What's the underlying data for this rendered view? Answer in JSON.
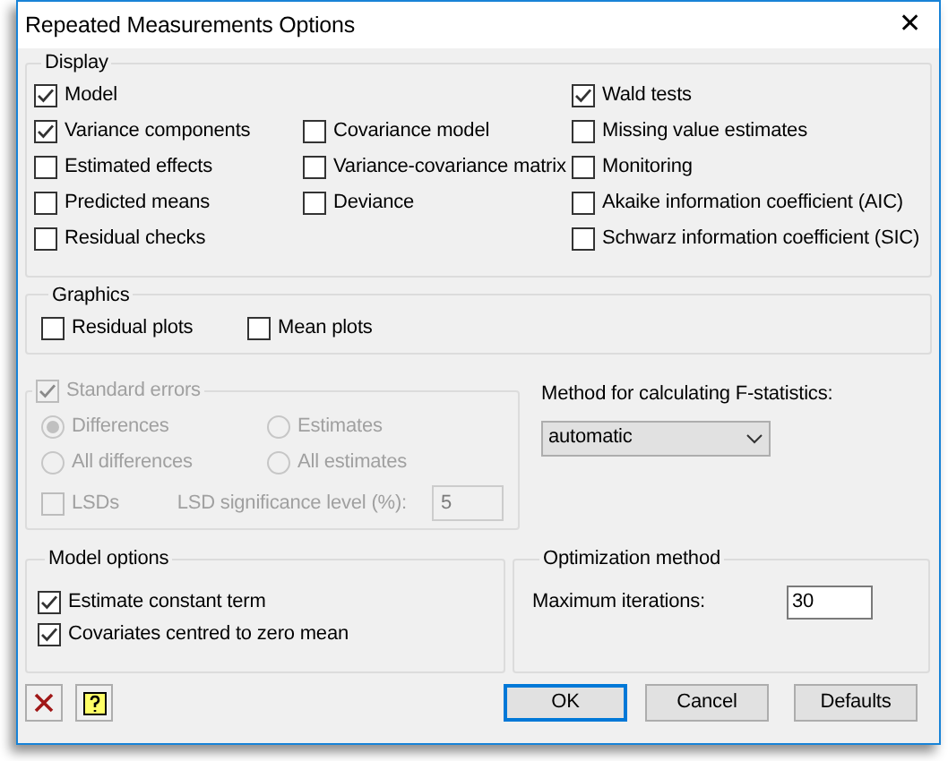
{
  "window": {
    "title": "Repeated Measurements Options",
    "close": "✕"
  },
  "display": {
    "title": "Display",
    "columns": [
      [
        {
          "label": "Model",
          "checked": true
        },
        {
          "label": "Variance components",
          "checked": true
        },
        {
          "label": "Estimated effects",
          "checked": false
        },
        {
          "label": "Predicted means",
          "checked": false
        },
        {
          "label": "Residual checks",
          "checked": false
        }
      ],
      [
        {
          "label": "Covariance model",
          "checked": false
        },
        {
          "label": "Variance-covariance matrix",
          "checked": false
        },
        {
          "label": "Deviance",
          "checked": false
        }
      ],
      [
        {
          "label": "Wald tests",
          "checked": true
        },
        {
          "label": "Missing value estimates",
          "checked": false
        },
        {
          "label": "Monitoring",
          "checked": false
        },
        {
          "label": "Akaike information coefficient (AIC)",
          "checked": false
        },
        {
          "label": "Schwarz information coefficient (SIC)",
          "checked": false
        }
      ]
    ]
  },
  "graphics": {
    "title": "Graphics",
    "items": [
      {
        "label": "Residual plots",
        "checked": false
      },
      {
        "label": "Mean plots",
        "checked": false
      }
    ]
  },
  "standard_errors": {
    "label": "Standard errors",
    "checked": true,
    "disabled": true,
    "options": [
      {
        "label": "Differences",
        "selected": true
      },
      {
        "label": "Estimates",
        "selected": false
      },
      {
        "label": "All differences",
        "selected": false
      },
      {
        "label": "All estimates",
        "selected": false
      }
    ],
    "lsds": {
      "label": "LSDs",
      "checked": false
    },
    "lsd_level": {
      "label": "LSD significance level (%):",
      "value": "5"
    }
  },
  "f_method": {
    "label": "Method for calculating F-statistics:",
    "value": "automatic"
  },
  "model_options": {
    "title": "Model options",
    "items": [
      {
        "label": "Estimate constant term",
        "checked": true
      },
      {
        "label": "Covariates centred to zero mean",
        "checked": true
      }
    ]
  },
  "optimization": {
    "title": "Optimization method",
    "label": "Maximum iterations:",
    "value": "30"
  },
  "buttons": [
    {
      "label": "OK",
      "default": true
    },
    {
      "label": "Cancel",
      "default": false
    },
    {
      "label": "Defaults",
      "default": false
    }
  ]
}
